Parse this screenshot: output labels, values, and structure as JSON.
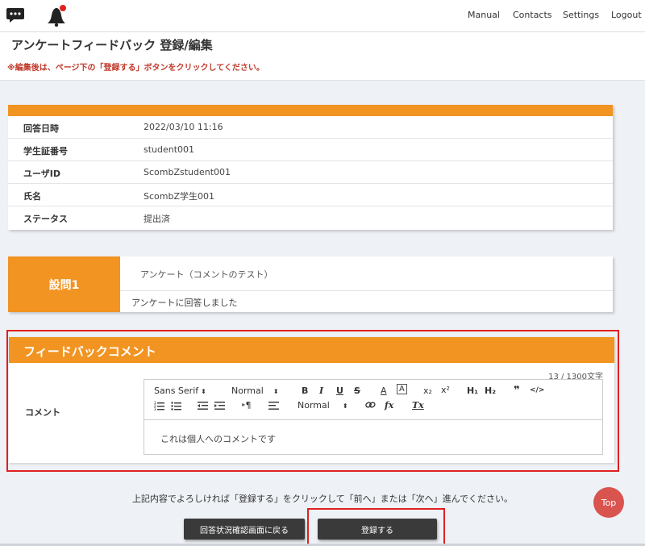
{
  "nav": {
    "links": [
      "Manual",
      "Contacts",
      "Settings",
      "Logout"
    ],
    "icons": [
      "chat-bubble-icon",
      "bell-icon"
    ],
    "notification_color": "#e02020"
  },
  "header": {
    "title": "アンケートフィードバック 登録/編集",
    "note": "※編集後は、ページ下の「登録する」ボタンをクリックしてください。"
  },
  "info": {
    "rows": [
      {
        "label": "回答日時",
        "value": "2022/03/10 11:16"
      },
      {
        "label": "学生証番号",
        "value": "student001"
      },
      {
        "label": "ユーザID",
        "value": "ScombZstudent001"
      },
      {
        "label": "氏名",
        "value": "ScombZ学生001"
      },
      {
        "label": "ステータス",
        "value": "提出済"
      }
    ]
  },
  "question": {
    "label": "設問1",
    "title": "アンケート（コメントのテスト）",
    "answer": "アンケートに回答しました"
  },
  "feedback": {
    "title": "フィードバックコメント",
    "counter": "13 / 1300文字",
    "label": "コメント",
    "content": "これは個人へのコメントです",
    "toolbar": {
      "font": "Sans Serif",
      "size": "Normal",
      "align": "Normal",
      "dropdown_arrow": "⬍",
      "bold": "B",
      "italic": "I",
      "underline": "U",
      "strike": "S",
      "font_color": "A",
      "background": "A",
      "subscript": "x₂",
      "superscript": "x²",
      "h1": "H₁",
      "h2": "H₂",
      "quote": "❞",
      "code": "</>",
      "rtl": "⁍¶",
      "formula": "fx",
      "clean": "Tx"
    }
  },
  "footer": {
    "message": "上記内容でよろしければ「登録する」をクリックして「前へ」または「次へ」進んでください。",
    "back_label": "回答状況確認画面に戻る",
    "submit_label": "登録する",
    "top_label": "Top"
  },
  "colors": {
    "accent": "#f29422",
    "highlight": "#e02020",
    "top_button": "#d9534f",
    "button": "#3a3a3a"
  }
}
